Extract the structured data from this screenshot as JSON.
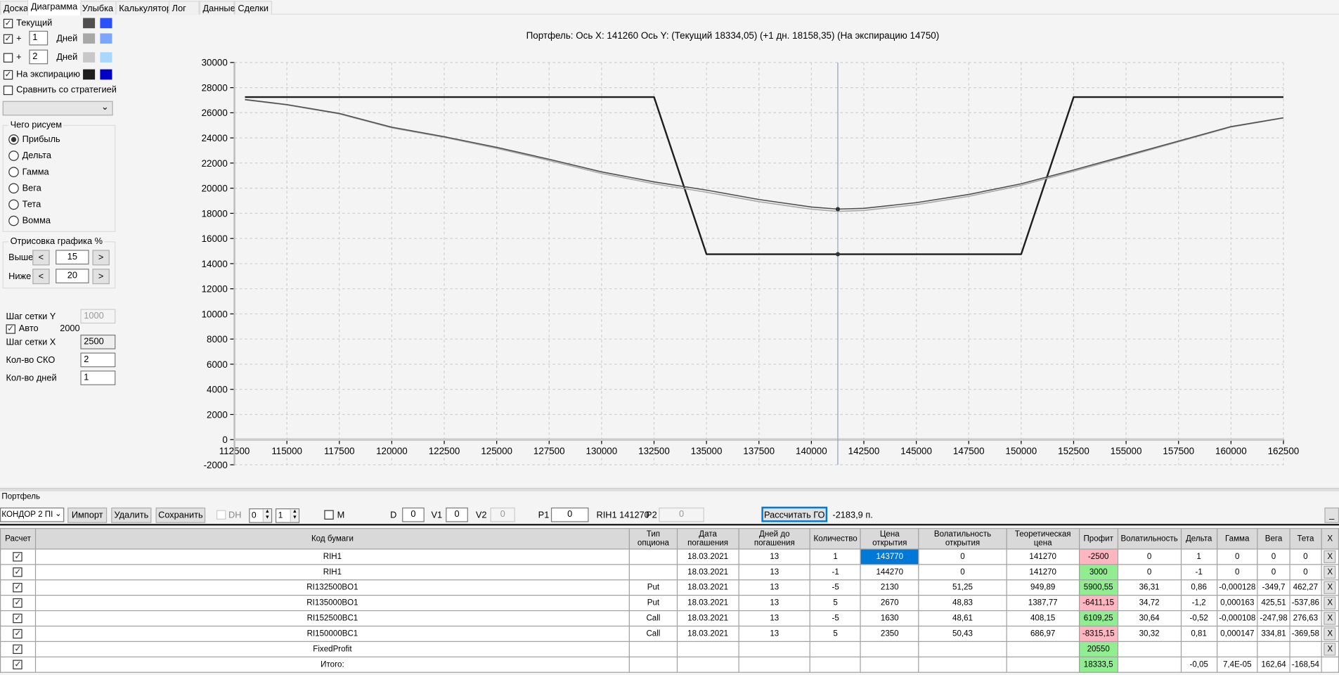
{
  "tabs": [
    "Доска",
    "Диаграмма",
    "Улыбка",
    "Калькулятор",
    "Лог",
    "Данные",
    "Сделки"
  ],
  "active_tab": "Диаграмма",
  "series_controls": [
    {
      "label": "Текущий",
      "checked": true,
      "colors": [
        "#505050",
        "#2a4fff"
      ]
    },
    {
      "label": "+",
      "days": "1",
      "days_label": "Дней",
      "checked": true,
      "colors": [
        "#a8a8a8",
        "#7aa6ff"
      ]
    },
    {
      "label": "+",
      "days": "2",
      "days_label": "Дней",
      "checked": false,
      "colors": [
        "#c8c8c8",
        "#a8d8ff"
      ]
    },
    {
      "label": "На экспирацию",
      "checked": true,
      "colors": [
        "#1e1e1e",
        "#0000c8"
      ]
    }
  ],
  "compare": {
    "label": "Сравнить со стратегией",
    "checked": false,
    "strategy": ""
  },
  "draw_group": {
    "title": "Чего рисуем",
    "options": [
      "Прибыль",
      "Дельта",
      "Гамма",
      "Вега",
      "Тета",
      "Вомма"
    ],
    "selected": "Прибыль"
  },
  "range_group": {
    "title": "Отрисовка графика %",
    "above_label": "Выше",
    "above": "15",
    "below_label": "Ниже",
    "below": "20",
    "dec": "<",
    "inc": ">"
  },
  "grid": {
    "y_label": "Шаг сетки Y",
    "y_value": "1000",
    "auto_label": "Авто",
    "auto_checked": true,
    "auto_value": "2000",
    "x_label": "Шаг сетки X",
    "x_value": "2500",
    "sko_label": "Кол-во СКО",
    "sko_value": "2",
    "days_label": "Кол-во дней",
    "days_value": "1"
  },
  "chart_data": {
    "type": "line",
    "title": "Портфель: Ось X: 141260 Ось Y:  (Текущий 18334,05)  (+1 дн. 18158,35)  (На экспирацию 14750)",
    "xlim": [
      112500,
      162500
    ],
    "ylim": [
      -2000,
      30000
    ],
    "xticks": [
      112500,
      115000,
      117500,
      120000,
      122500,
      125000,
      127500,
      130000,
      132500,
      135000,
      137500,
      140000,
      142500,
      145000,
      147500,
      150000,
      152500,
      155000,
      157500,
      160000,
      162500
    ],
    "yticks": [
      -2000,
      0,
      2000,
      4000,
      6000,
      8000,
      10000,
      12000,
      14000,
      16000,
      18000,
      20000,
      22000,
      24000,
      26000,
      28000,
      30000
    ],
    "grid": true,
    "cursor_x": 141260,
    "series": [
      {
        "key": "current",
        "color": "#505050",
        "x": [
          113000,
          115000,
          117500,
          120000,
          122500,
          125000,
          127500,
          130000,
          132500,
          135000,
          137500,
          140000,
          141260,
          142500,
          145000,
          147500,
          150000,
          152500,
          155000,
          157500,
          160000,
          162500
        ],
        "y": [
          27050,
          26650,
          25950,
          24850,
          24100,
          23250,
          22300,
          21300,
          20500,
          19850,
          19100,
          18500,
          18334,
          18400,
          18850,
          19500,
          20350,
          21450,
          22600,
          23750,
          24900,
          25600
        ]
      },
      {
        "key": "plus1",
        "color": "#a8a8a8",
        "x": [
          113000,
          115000,
          117500,
          120000,
          122500,
          125000,
          127500,
          130000,
          132500,
          135000,
          137500,
          140000,
          141260,
          142500,
          145000,
          147500,
          150000,
          152500,
          155000,
          157500,
          160000,
          162500
        ],
        "y": [
          27030,
          26620,
          25910,
          24800,
          24040,
          23170,
          22200,
          21170,
          20350,
          19680,
          18930,
          18330,
          18158,
          18230,
          18690,
          19350,
          20220,
          21340,
          22510,
          23690,
          24860,
          25580
        ]
      },
      {
        "key": "expiration",
        "color": "#1e1e1e",
        "x": [
          113000,
          132500,
          135000,
          150000,
          152500,
          162500
        ],
        "y": [
          27250,
          27250,
          14750,
          14750,
          27250,
          27250
        ]
      }
    ],
    "markers": [
      {
        "x": 141260,
        "y": 18334.05
      },
      {
        "x": 141260,
        "y": 14750
      }
    ]
  },
  "portfolio": {
    "title": "Портфель",
    "strategy": "КОНДОР 2 ПІ",
    "import": "Импорт",
    "delete": "Удалить",
    "save": "Сохранить",
    "dh_label": "DH",
    "spin1": "0",
    "spin2": "1",
    "m_label": "M",
    "d_label": "D",
    "d": "0",
    "v1_label": "V1",
    "v1": "0",
    "v2_label": "V2",
    "v2": "0",
    "p1_label": "P1",
    "p1": "0",
    "instrument": "RIH1 141270",
    "p2_label": "P2",
    "p2": "0",
    "calc_go": "Рассчитать ГО",
    "go_value": "-2183,9 п.",
    "minimize": "_"
  },
  "table": {
    "headers": [
      "Расчет",
      "Код бумаги",
      "Тип опциона",
      "Дата погашения",
      "Дней до погашения",
      "Количество",
      "Цена открытия",
      "Волатильность открытия",
      "Теоретическая цена",
      "Профит",
      "Волатильность",
      "Дельта",
      "Гамма",
      "Вега",
      "Тета",
      "X"
    ],
    "rows": [
      {
        "code": "RIH1",
        "type": "",
        "date": "18.03.2021",
        "days": "13",
        "qty": "1",
        "open": "143770",
        "vol_open": "0",
        "theo": "141270",
        "profit": "-2500",
        "vol": "0",
        "delta": "1",
        "gamma": "0",
        "vega": "0",
        "theta": "0",
        "x": "X"
      },
      {
        "code": "RIH1",
        "type": "",
        "date": "18.03.2021",
        "days": "13",
        "qty": "-1",
        "open": "144270",
        "vol_open": "0",
        "theo": "141270",
        "profit": "3000",
        "vol": "0",
        "delta": "-1",
        "gamma": "0",
        "vega": "0",
        "theta": "0",
        "x": "X"
      },
      {
        "code": "RI132500BO1",
        "type": "Put",
        "date": "18.03.2021",
        "days": "13",
        "qty": "-5",
        "open": "2130",
        "vol_open": "51,25",
        "theo": "949,89",
        "profit": "5900,55",
        "vol": "36,31",
        "delta": "0,86",
        "gamma": "-0,000128",
        "vega": "-349,7",
        "theta": "462,27",
        "x": "X"
      },
      {
        "code": "RI135000BO1",
        "type": "Put",
        "date": "18.03.2021",
        "days": "13",
        "qty": "5",
        "open": "2670",
        "vol_open": "48,83",
        "theo": "1387,77",
        "profit": "-6411,15",
        "vol": "34,72",
        "delta": "-1,2",
        "gamma": "0,000163",
        "vega": "425,51",
        "theta": "-537,86",
        "x": "X"
      },
      {
        "code": "RI152500BC1",
        "type": "Call",
        "date": "18.03.2021",
        "days": "13",
        "qty": "-5",
        "open": "1630",
        "vol_open": "48,61",
        "theo": "408,15",
        "profit": "6109,25",
        "vol": "30,64",
        "delta": "-0,52",
        "gamma": "-0,000108",
        "vega": "-247,98",
        "theta": "276,63",
        "x": "X"
      },
      {
        "code": "RI150000BC1",
        "type": "Call",
        "date": "18.03.2021",
        "days": "13",
        "qty": "5",
        "open": "2350",
        "vol_open": "50,43",
        "theo": "686,97",
        "profit": "-8315,15",
        "vol": "30,32",
        "delta": "0,81",
        "gamma": "0,000147",
        "vega": "334,81",
        "theta": "-369,58",
        "x": "X"
      },
      {
        "code": "FixedProfit",
        "type": "",
        "date": "",
        "days": "",
        "qty": "",
        "open": "",
        "vol_open": "",
        "theo": "",
        "profit": "20550",
        "vol": "",
        "delta": "",
        "gamma": "",
        "vega": "",
        "theta": "",
        "x": "X"
      },
      {
        "code": "Итого:",
        "type": "",
        "date": "",
        "days": "",
        "qty": "",
        "open": "",
        "vol_open": "",
        "theo": "",
        "profit": "18333,5",
        "vol": "",
        "delta": "-0,05",
        "gamma": "7,4E-05",
        "vega": "162,64",
        "theta": "-168,54",
        "x": ""
      }
    ]
  }
}
